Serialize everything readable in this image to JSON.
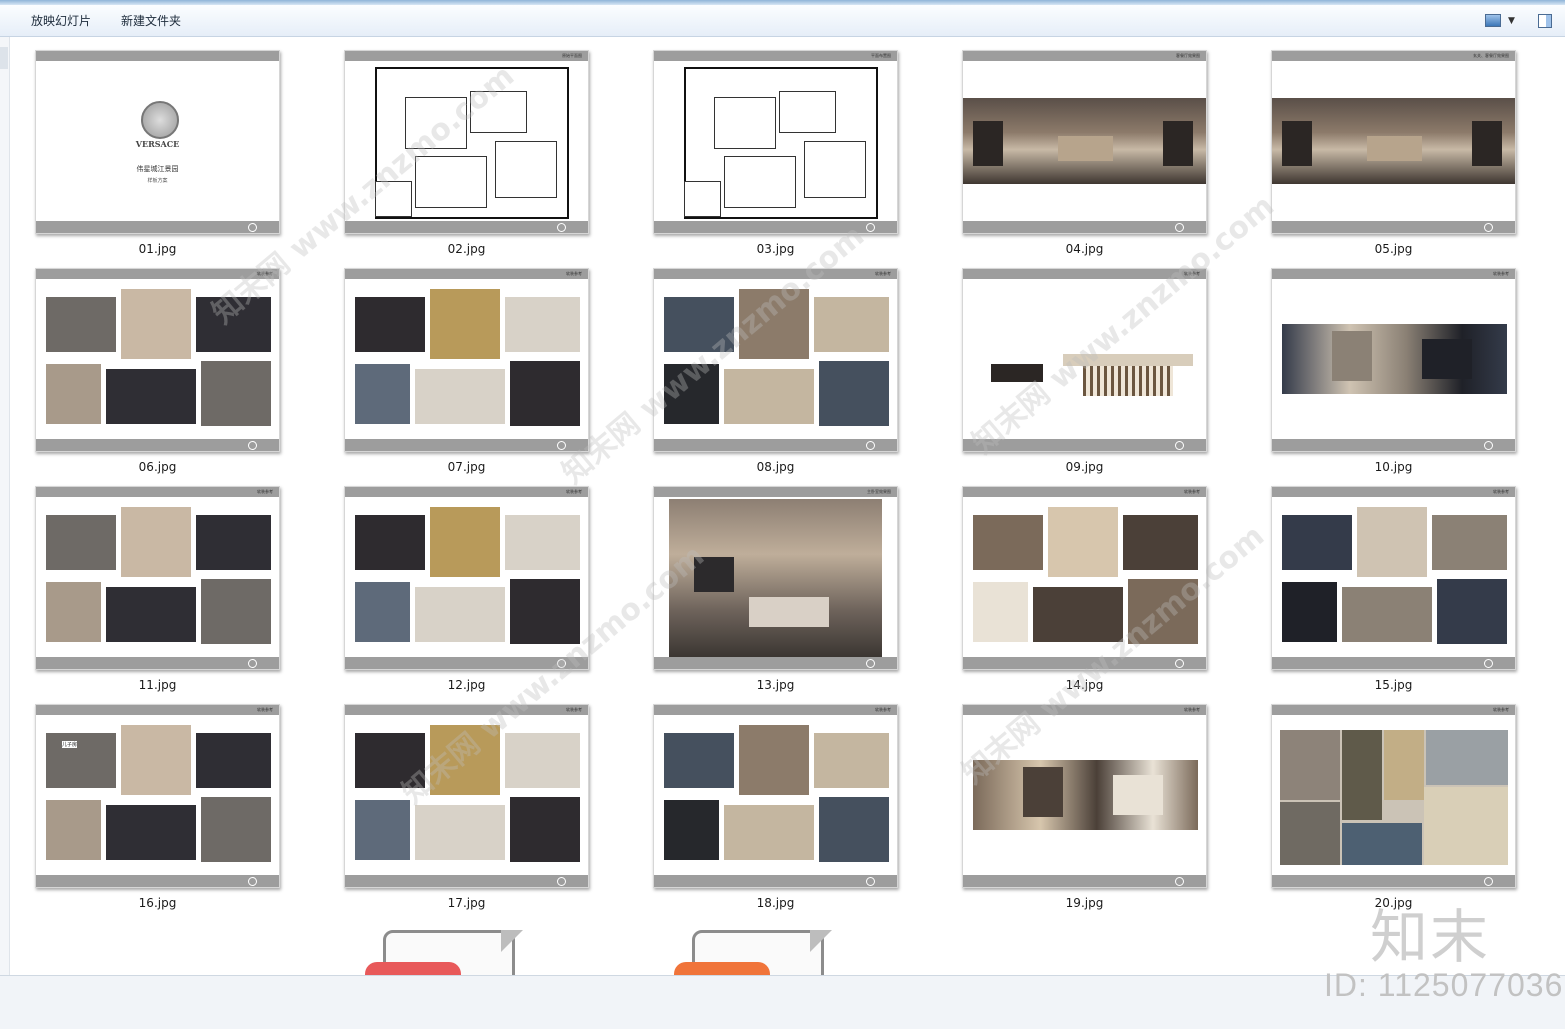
{
  "toolbar": {
    "slideshow_label": "放映幻灯片",
    "new_folder_label": "新建文件夹",
    "view_icon": "view-options-icon",
    "pane_icon": "preview-pane-icon"
  },
  "thumbnails": [
    {
      "name": "01.jpg",
      "tag": "",
      "art": "logo",
      "title": "伟星城江景园",
      "subtitle": "样板方案",
      "logo_text": "VERSACE"
    },
    {
      "name": "02.jpg",
      "tag": "原始平面图",
      "art": "plan"
    },
    {
      "name": "03.jpg",
      "tag": "平面布置图",
      "art": "plan"
    },
    {
      "name": "04.jpg",
      "tag": "客餐厅效果图",
      "art": "panorama"
    },
    {
      "name": "05.jpg",
      "tag": "玄关、客餐厅效果图",
      "art": "panorama"
    },
    {
      "name": "06.jpg",
      "tag": "软装参考",
      "art": "collage"
    },
    {
      "name": "07.jpg",
      "tag": "软装参考",
      "art": "collage"
    },
    {
      "name": "08.jpg",
      "tag": "软装参考",
      "art": "collage"
    },
    {
      "name": "09.jpg",
      "tag": "软装参考",
      "art": "sparse"
    },
    {
      "name": "10.jpg",
      "tag": "软装参考",
      "art": "strip"
    },
    {
      "name": "11.jpg",
      "tag": "软装参考",
      "art": "collage"
    },
    {
      "name": "12.jpg",
      "tag": "软装参考",
      "art": "collage"
    },
    {
      "name": "13.jpg",
      "tag": "主卧室效果图",
      "art": "room"
    },
    {
      "name": "14.jpg",
      "tag": "软装参考",
      "art": "collage"
    },
    {
      "name": "15.jpg",
      "tag": "软装参考",
      "art": "collage"
    },
    {
      "name": "16.jpg",
      "tag": "软装参考",
      "art": "collage",
      "label": "儿子房"
    },
    {
      "name": "17.jpg",
      "tag": "软装参考",
      "art": "collage"
    },
    {
      "name": "18.jpg",
      "tag": "软装参考",
      "art": "collage"
    },
    {
      "name": "19.jpg",
      "tag": "软装参考",
      "art": "strip"
    },
    {
      "name": "20.jpg",
      "tag": "软装参考",
      "art": "materials"
    }
  ],
  "colors": {
    "slide_bar": "#9d9d9d",
    "toolbar_bg": "#e6eef8",
    "badge_red": "#e8595a",
    "badge_orange": "#f0743a"
  },
  "watermark": {
    "text": "知末网 www.znzmo.com",
    "brand": "知末",
    "id": "ID: 1125077036"
  }
}
